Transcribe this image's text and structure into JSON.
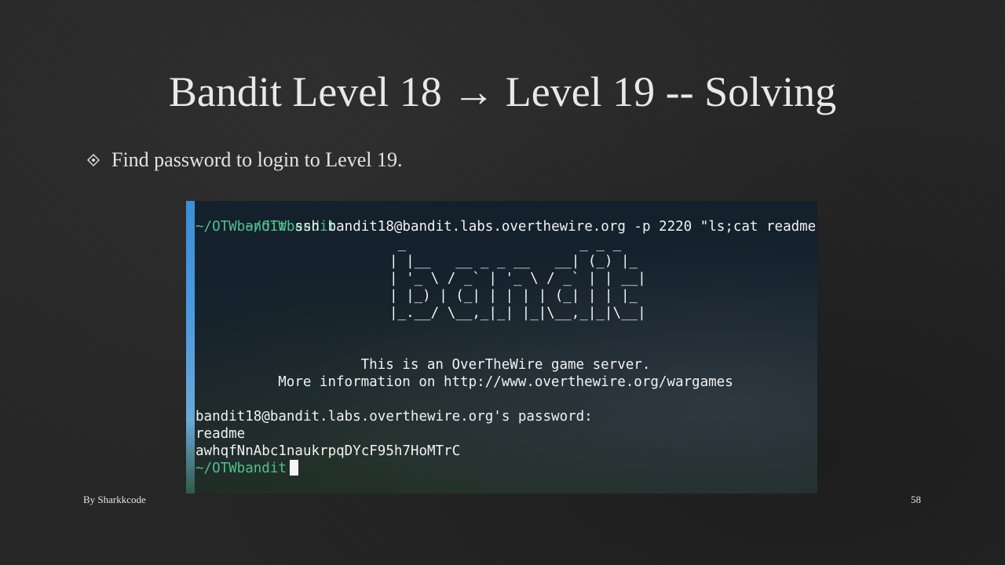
{
  "slide": {
    "title": "Bandit Level 18 → Level 19 -- Solving",
    "bullet": {
      "icon": "diamond-bullet-icon",
      "text": "Find password to login to Level 19."
    },
    "footer": {
      "author": "By Sharkkcode",
      "page_number": "58"
    }
  },
  "terminal": {
    "prompt_path": "~/OTWbandit",
    "command": "ssh bandit18@bandit.labs.overthewire.org -p 2220 \"ls;cat readme\"",
    "banner_ascii": [
      " _                     _ _ _   ",
      "| |__   __ _ _ __   __| (_) |_ ",
      "| '_ \\ / _` | '_ \\ / _` | | __|",
      "| |_) | (_| | | | | (_| | | |_ ",
      "|_.__/ \\__,_|_| |_|\\__,_|_|\\__|"
    ],
    "info_line_1": "This is an OverTheWire game server.",
    "info_line_2": "More information on http://www.overthewire.org/wargames",
    "password_prompt": "bandit18@bandit.labs.overthewire.org's password:",
    "output_file": "readme",
    "output_password": "awhqfNnAbc1naukrpqDYcF95h7HoMTrC"
  },
  "colors": {
    "prompt_green": "#4fc08d",
    "terminal_text": "#f2f2f2",
    "slide_text": "#e8e8e8"
  }
}
